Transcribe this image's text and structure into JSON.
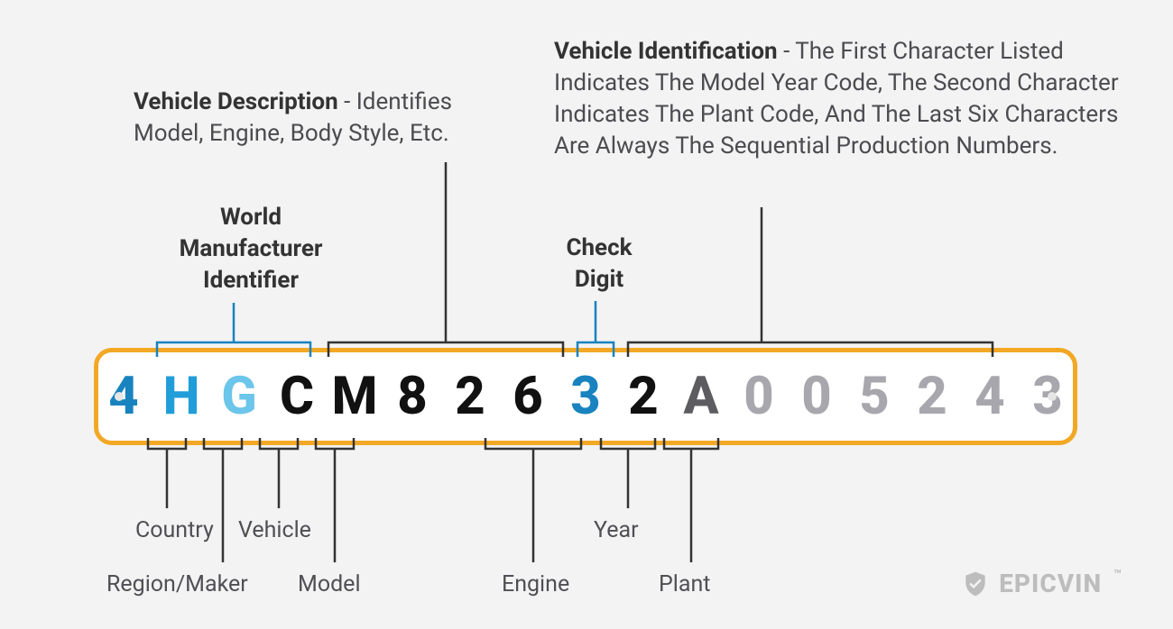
{
  "labels": {
    "wmi": "World\nManufacturer\nIdentifier",
    "vds_t": "Vehicle Description",
    "vds_b": " - Identifies Model, Engine, Body Style, Etc.",
    "check": "Check\nDigit",
    "vis_t": "Vehicle Identification",
    "vis_b": " - The First Character Listed Indicates The Model Year Code, The Second Character Indicates The Plant Code, And The Last Six Characters Are Always The Sequential Production Numbers."
  },
  "vin": [
    {
      "ch": "4",
      "cls": "c-blue-d"
    },
    {
      "ch": "H",
      "cls": "c-blue-m"
    },
    {
      "ch": "G",
      "cls": "c-blue-l"
    },
    {
      "ch": "C",
      "cls": "c-black"
    },
    {
      "ch": "M",
      "cls": "c-black"
    },
    {
      "ch": "8",
      "cls": "c-black"
    },
    {
      "ch": "2",
      "cls": "c-black"
    },
    {
      "ch": "6",
      "cls": "c-black"
    },
    {
      "ch": "3",
      "cls": "c-blue-d"
    },
    {
      "ch": "2",
      "cls": "c-black"
    },
    {
      "ch": "A",
      "cls": "c-gray-d"
    },
    {
      "ch": "0",
      "cls": "c-gray-l"
    },
    {
      "ch": "0",
      "cls": "c-gray-l"
    },
    {
      "ch": "5",
      "cls": "c-gray-l"
    },
    {
      "ch": "2",
      "cls": "c-gray-l"
    },
    {
      "ch": "4",
      "cls": "c-gray-l"
    },
    {
      "ch": "3",
      "cls": "c-gray-l"
    }
  ],
  "sub": {
    "country": "Country",
    "vehicle": "Vehicle",
    "region": "Region/Maker",
    "model": "Model",
    "engine": "Engine",
    "year": "Year",
    "plant": "Plant"
  },
  "brand": {
    "name": "EPICVIN",
    "tm": "™"
  }
}
